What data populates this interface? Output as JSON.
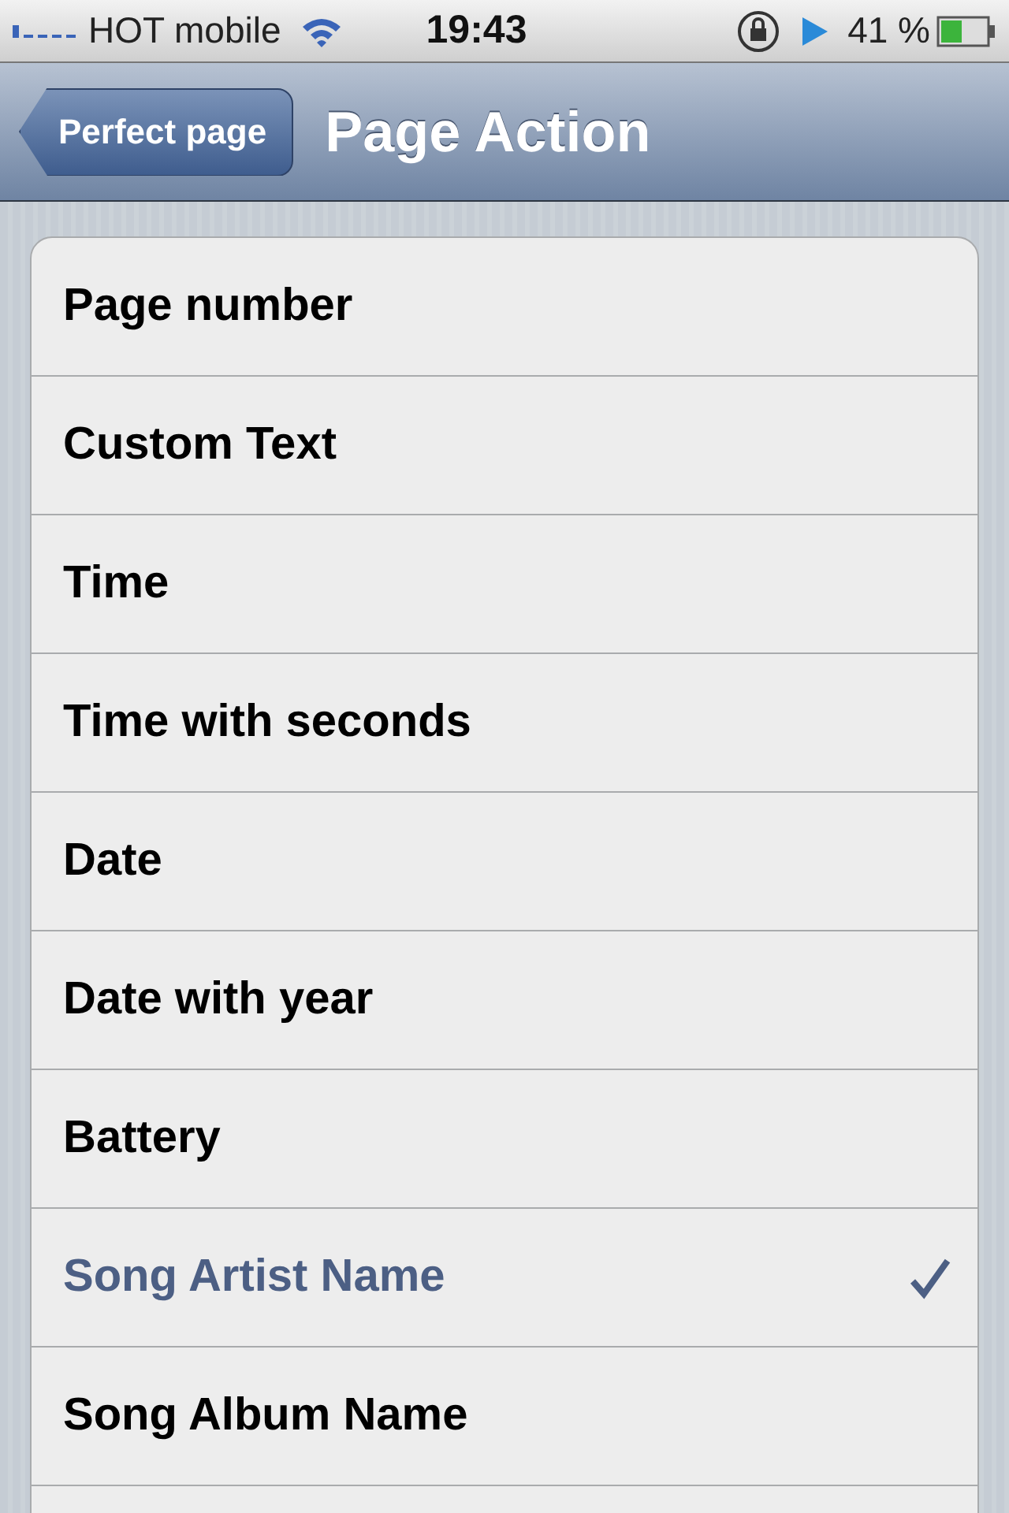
{
  "status_bar": {
    "carrier": "HOT mobile",
    "time": "19:43",
    "battery": "41 %"
  },
  "nav_bar": {
    "back": "Perfect page",
    "title": "Page Action"
  },
  "options": [
    {
      "label": "Page number",
      "selected": false
    },
    {
      "label": "Custom Text",
      "selected": false
    },
    {
      "label": "Time",
      "selected": false
    },
    {
      "label": "Time with seconds",
      "selected": false
    },
    {
      "label": "Date",
      "selected": false
    },
    {
      "label": "Date with year",
      "selected": false
    },
    {
      "label": "Battery",
      "selected": false
    },
    {
      "label": "Song Artist Name",
      "selected": true
    },
    {
      "label": "Song Album Name",
      "selected": false
    }
  ]
}
